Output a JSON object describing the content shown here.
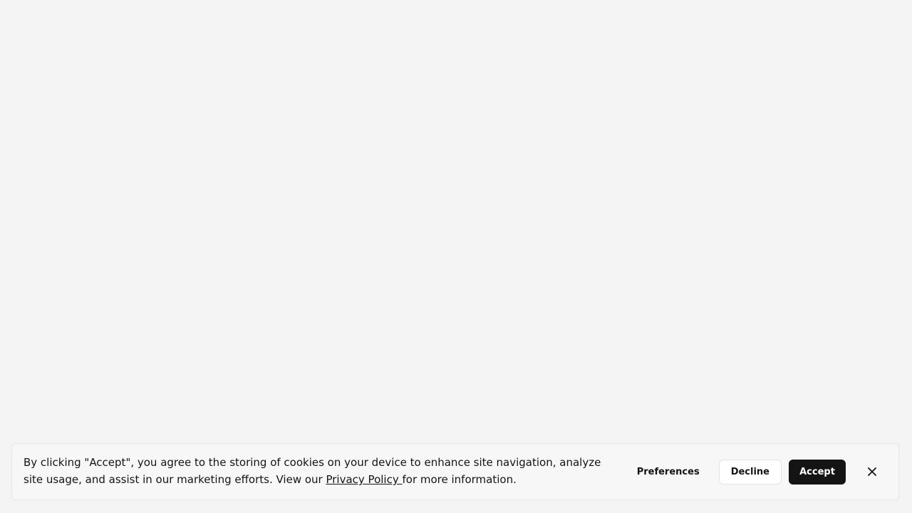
{
  "cookie_banner": {
    "message_before_link": "By clicking \"Accept\", you agree to the storing of cookies on your device to enhance site navigation, analyze site usage, and assist in our marketing efforts. View our ",
    "privacy_link_text": "Privacy Policy ",
    "message_after_link": "for more information.",
    "buttons": {
      "preferences": "Preferences",
      "decline": "Decline",
      "accept": "Accept"
    },
    "close_icon": "close-icon"
  },
  "colors": {
    "page_background": "#f4f4f4",
    "banner_background": "#f7f7f7",
    "accept_button": "#141414",
    "text": "#141414"
  }
}
